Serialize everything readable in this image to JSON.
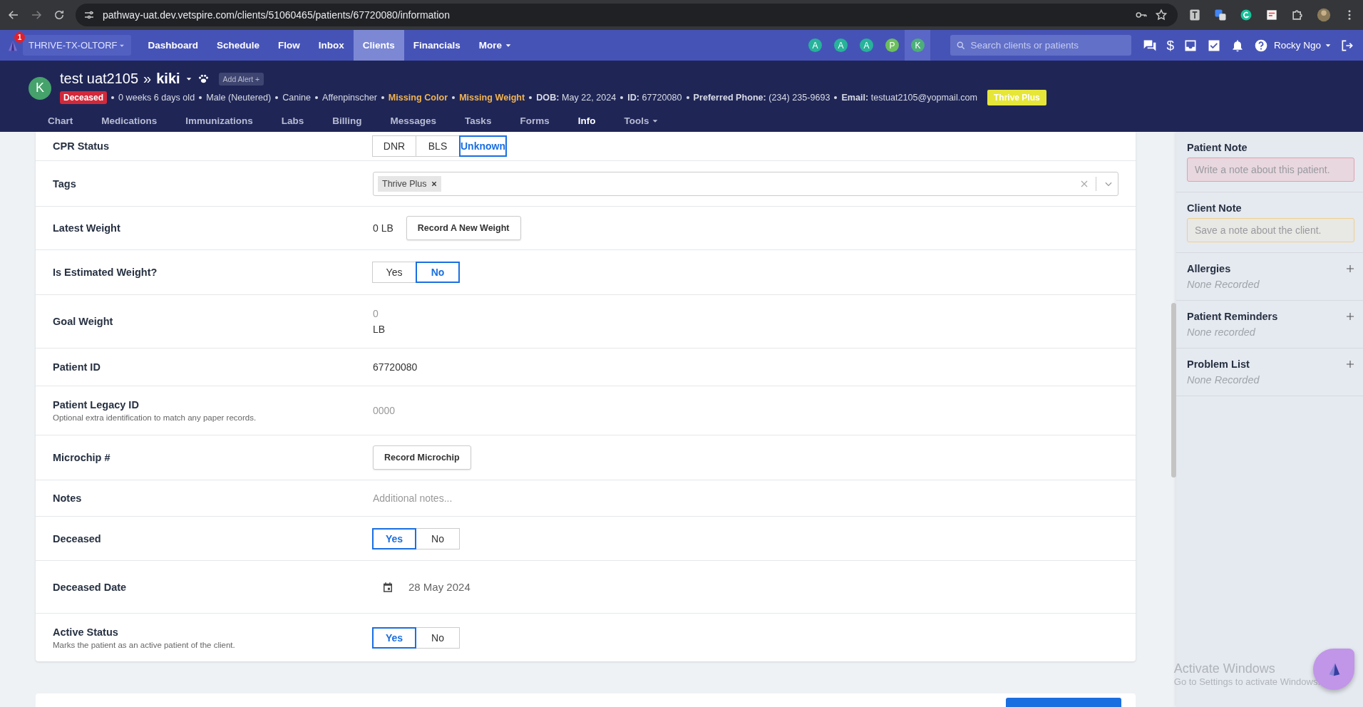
{
  "browser": {
    "url": "pathway-uat.dev.vetspire.com/clients/51060465/patients/67720080/information"
  },
  "nav": {
    "location": "THRIVE-TX-OLTORF",
    "notification_count": "1",
    "items": [
      {
        "label": "Dashboard",
        "selected": false
      },
      {
        "label": "Schedule",
        "selected": false
      },
      {
        "label": "Flow",
        "selected": false
      },
      {
        "label": "Inbox",
        "selected": false
      },
      {
        "label": "Clients",
        "selected": true
      },
      {
        "label": "Financials",
        "selected": false
      },
      {
        "label": "More",
        "selected": false,
        "dropdown": true
      }
    ],
    "avatars": [
      {
        "letter": "A",
        "color": "#26b39a",
        "selected": false
      },
      {
        "letter": "A",
        "color": "#26b39a",
        "selected": false
      },
      {
        "letter": "A",
        "color": "#26b39a",
        "selected": false
      },
      {
        "letter": "P",
        "color": "#6cbf5c",
        "selected": false
      },
      {
        "letter": "K",
        "color": "#4caf7a",
        "selected": true
      }
    ],
    "search": {
      "placeholder": "Search clients or patients"
    },
    "dollar": "$",
    "user": "Rocky Ngo"
  },
  "patient": {
    "avatar": "K",
    "client": "test uat2105",
    "separator": "»",
    "name": "kiki",
    "add_alert": "Add Alert +",
    "status_badge": "Deceased",
    "facts": [
      {
        "kind": "plain",
        "text": "0 weeks 6 days old"
      },
      {
        "kind": "plain",
        "text": "Male (Neutered)"
      },
      {
        "kind": "plain",
        "text": "Canine"
      },
      {
        "kind": "plain",
        "text": "Affenpinscher"
      },
      {
        "kind": "warning",
        "text": "Missing Color"
      },
      {
        "kind": "warning",
        "text": "Missing Weight"
      },
      {
        "kind": "field",
        "label": "DOB:",
        "text": "May 22, 2024"
      },
      {
        "kind": "field",
        "label": "ID:",
        "text": "67720080"
      },
      {
        "kind": "field",
        "label": "Preferred Phone:",
        "text": "(234) 235-9693"
      },
      {
        "kind": "field",
        "label": "Email:",
        "text": "testuat2105@yopmail.com"
      }
    ],
    "plan": "Thrive Plus"
  },
  "tabs": [
    {
      "label": "Chart",
      "selected": false
    },
    {
      "label": "Medications",
      "selected": false
    },
    {
      "label": "Immunizations",
      "selected": false
    },
    {
      "label": "Labs",
      "selected": false
    },
    {
      "label": "Billing",
      "selected": false
    },
    {
      "label": "Messages",
      "selected": false
    },
    {
      "label": "Tasks",
      "selected": false
    },
    {
      "label": "Forms",
      "selected": false
    },
    {
      "label": "Info",
      "selected": true
    },
    {
      "label": "Tools",
      "selected": false,
      "dropdown": true
    }
  ],
  "rows": [
    {
      "label": "CPR Status",
      "kind": "segmented",
      "options": [
        {
          "label": "DNR",
          "selected": false
        },
        {
          "label": "BLS",
          "selected": false
        },
        {
          "label": "Unknown",
          "selected": true
        }
      ]
    },
    {
      "label": "Tags",
      "kind": "tags",
      "tags": [
        "Thrive Plus"
      ]
    },
    {
      "label": "Latest Weight",
      "kind": "weight",
      "value": "0",
      "unit": "LB",
      "button": "Record A New Weight"
    },
    {
      "label": "Is Estimated Weight?",
      "kind": "segmented",
      "options": [
        {
          "label": "Yes",
          "selected": false
        },
        {
          "label": "No",
          "selected": true
        }
      ]
    },
    {
      "label": "Goal Weight",
      "kind": "goal",
      "placeholder": "0",
      "unit": "LB"
    },
    {
      "label": "Patient ID",
      "kind": "text",
      "value": "67720080"
    },
    {
      "label": "Patient Legacy ID",
      "hint": "Optional extra identification to match any paper records.",
      "kind": "input",
      "placeholder": "0000"
    },
    {
      "label": "Microchip #",
      "kind": "button",
      "button": "Record Microchip"
    },
    {
      "label": "Notes",
      "kind": "input",
      "placeholder": "Additional notes..."
    },
    {
      "label": "Deceased",
      "kind": "segmented",
      "options": [
        {
          "label": "Yes",
          "selected": true
        },
        {
          "label": "No",
          "selected": false
        }
      ]
    },
    {
      "label": "Deceased Date",
      "kind": "date",
      "value": "28 May 2024"
    },
    {
      "label": "Active Status",
      "hint": "Marks the patient as an active patient of the client.",
      "kind": "segmented",
      "options": [
        {
          "label": "Yes",
          "selected": true
        },
        {
          "label": "No",
          "selected": false
        }
      ]
    }
  ],
  "sidebar": {
    "notes": [
      {
        "title": "Patient Note",
        "placeholder": "Write a note about this patient.",
        "kind": "alert"
      },
      {
        "title": "Client Note",
        "placeholder": "Save a note about the client.",
        "kind": "warning"
      }
    ],
    "lists": [
      {
        "title": "Allergies",
        "empty": "None Recorded"
      },
      {
        "title": "Patient Reminders",
        "empty": "None recorded"
      },
      {
        "title": "Problem List",
        "empty": "None Recorded"
      }
    ]
  },
  "os_notice": {
    "title": "Activate Windows",
    "text": "Go to Settings to activate Windows."
  }
}
